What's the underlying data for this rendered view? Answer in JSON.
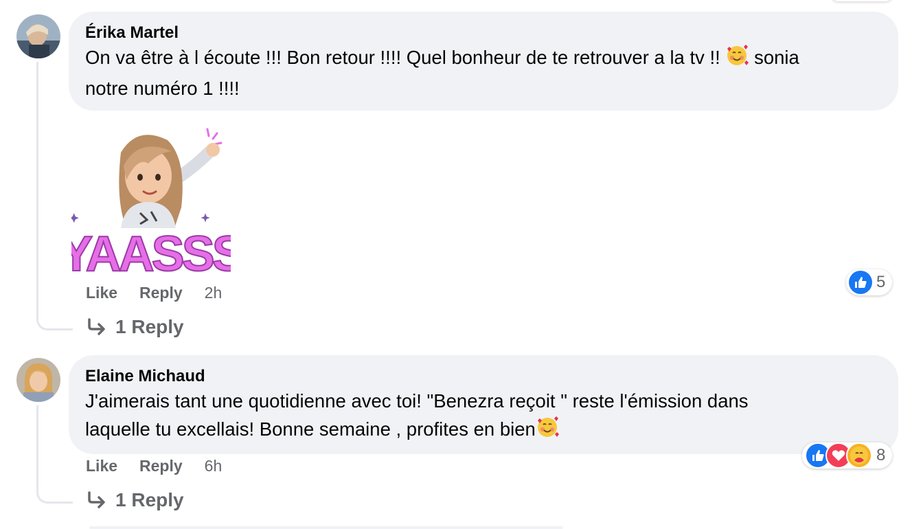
{
  "comments": [
    {
      "author": "Érika Martel",
      "text_1": "On va être à l écoute !!! Bon retour !!!! Quel bonheur de te retrouver a la tv !!",
      "text_2": "sonia",
      "text_3": "notre numéro 1 !!!!",
      "sticker_text": "YAASSS",
      "like_label": "Like",
      "reply_label": "Reply",
      "time": "2h",
      "reaction_count": "5",
      "replies_label": "1 Reply"
    },
    {
      "author": "Elaine Michaud",
      "text_1": "J'aimerais tant une quotidienne avec toi! \"Benezra reçoit \" reste l'émission dans",
      "text_2": "laquelle tu excellais! Bonne semaine , profites en bien",
      "like_label": "Like",
      "reply_label": "Reply",
      "time": "6h",
      "reaction_count": "8",
      "replies_label": "1 Reply"
    }
  ],
  "colors": {
    "bubble": "#f0f2f5",
    "meta_text": "#65676b",
    "like_blue": "#1877f2",
    "love_red": "#f33e58",
    "care_yellow": "#f7b125",
    "sticker_pink": "#e66ee6"
  },
  "icons": [
    "like-icon",
    "love-icon",
    "care-icon",
    "reply-arrow-icon",
    "smiling-hearts-emoji"
  ]
}
